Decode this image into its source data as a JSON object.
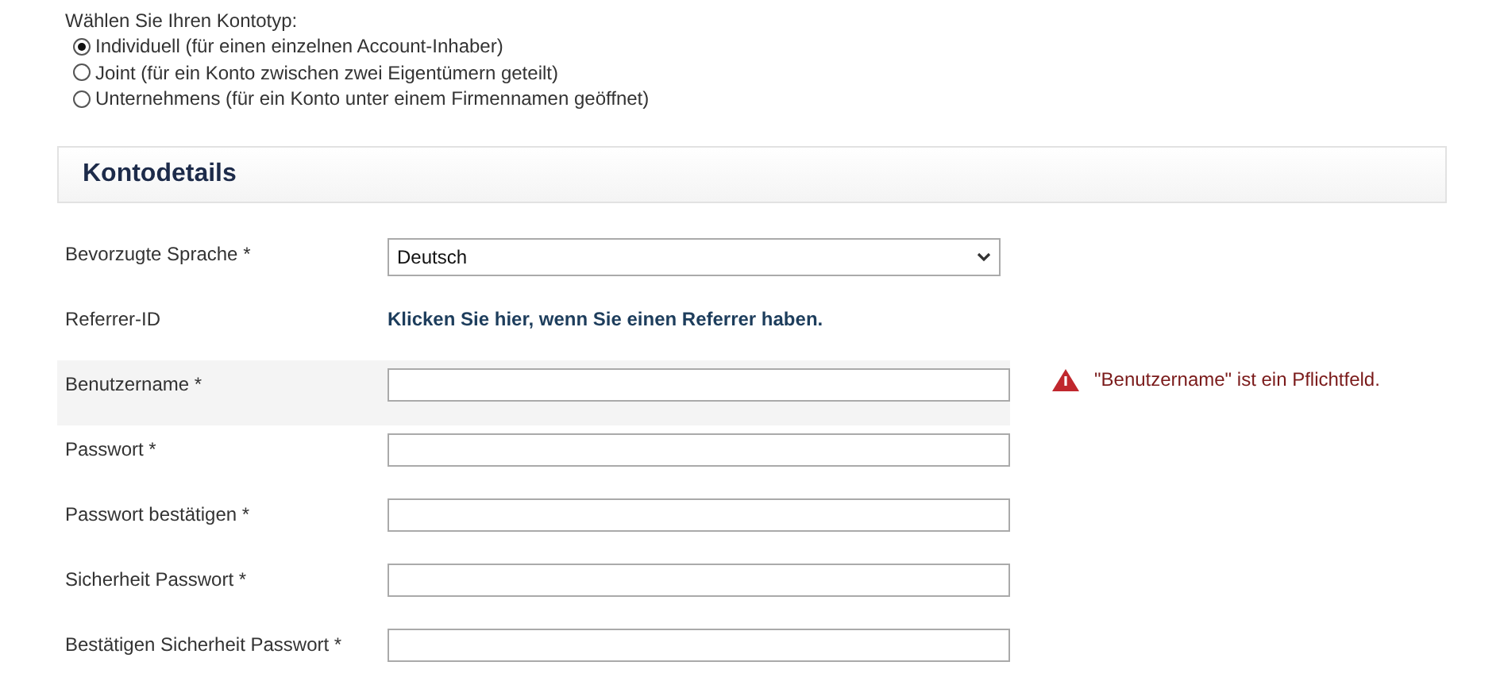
{
  "account_type": {
    "label": "Wählen Sie Ihren Kontotyp:",
    "options": [
      {
        "label": "Individuell (für einen einzelnen Account-Inhaber)",
        "selected": true
      },
      {
        "label": "Joint (für ein Konto zwischen zwei Eigentümern geteilt)",
        "selected": false
      },
      {
        "label": "Unternehmens (für ein Konto unter einem Firmennamen geöffnet)",
        "selected": false
      }
    ]
  },
  "section": {
    "title": "Kontodetails"
  },
  "rows": [
    {
      "label": "Bevorzugte Sprache *",
      "kind": "select",
      "value": "Deutsch"
    },
    {
      "label": "Referrer-ID",
      "kind": "link",
      "value": "Klicken Sie hier, wenn Sie einen Referrer haben."
    },
    {
      "label": "Benutzername *",
      "kind": "text",
      "error": "\"Benutzername\" ist ein Pflichtfeld."
    },
    {
      "label": "Passwort *",
      "kind": "text"
    },
    {
      "label": "Passwort bestätigen *",
      "kind": "text"
    },
    {
      "label": "Sicherheit Passwort *",
      "kind": "text"
    },
    {
      "label": "Bestätigen Sicherheit Passwort *",
      "kind": "text"
    }
  ]
}
